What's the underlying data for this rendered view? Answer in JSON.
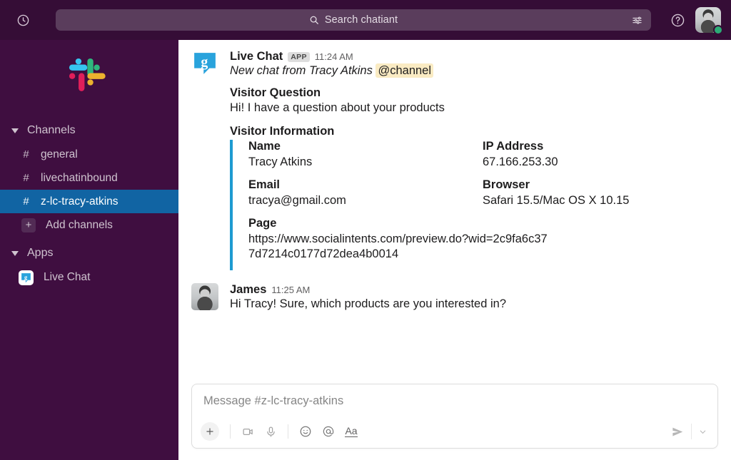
{
  "topbar": {
    "history_icon": "clock-icon",
    "search_placeholder": "Search chatiant",
    "search_icon": "search-icon",
    "filter_icon": "filter-sliders-icon",
    "help_icon": "help-circle-icon",
    "avatar_icon": "user-avatar",
    "presence": "online"
  },
  "sidebar": {
    "logo": "slack-logo",
    "sections": [
      {
        "label": "Channels",
        "items": [
          {
            "label": "general",
            "prefix": "#",
            "selected": false
          },
          {
            "label": "livechatinbound",
            "prefix": "#",
            "selected": false
          },
          {
            "label": "z-lc-tracy-atkins",
            "prefix": "#",
            "selected": true
          },
          {
            "label": "Add channels",
            "prefix": "+",
            "selected": false
          }
        ]
      },
      {
        "label": "Apps",
        "items": [
          {
            "label": "Live Chat",
            "prefix": "app",
            "selected": false
          }
        ]
      }
    ]
  },
  "messages": [
    {
      "author": "Live Chat",
      "badge": "APP",
      "time": "11:24 AM",
      "subtitle_prefix": "New chat from Tracy Atkins ",
      "mention": "@channel",
      "question_title": "Visitor Question",
      "question_text": "Hi!  I have a question about your products",
      "info_title": "Visitor Information",
      "fields": [
        {
          "label": "Name",
          "value": "Tracy Atkins"
        },
        {
          "label": "IP Address",
          "value": "67.166.253.30"
        },
        {
          "label": "Email",
          "value": "tracya@gmail.com"
        },
        {
          "label": "Browser",
          "value": "Safari 15.5/Mac OS X 10.15"
        },
        {
          "label": "Page",
          "value": "https://www.socialintents.com/preview.do?wid=2c9fa6c377d7214c0177d72dea4b0014"
        }
      ]
    },
    {
      "author": "James",
      "time": "11:25 AM",
      "text": "Hi Tracy!  Sure, which products are you interested in?"
    }
  ],
  "composer": {
    "placeholder": "Message #z-lc-tracy-atkins",
    "tools": [
      "plus-icon",
      "video-icon",
      "microphone-icon",
      "emoji-icon",
      "mention-at-icon",
      "formatting-aa-icon"
    ],
    "aa_label": "Aa",
    "send_icon": "send-icon",
    "chevron_icon": "chevron-down-icon"
  },
  "colors": {
    "sidebar_bg": "#3F0E40",
    "topbar_bg": "#350D36",
    "selected_channel": "#1164A3",
    "attachment_border": "#1D9BD1",
    "mention_highlight": "#FAEBC3",
    "presence_green": "#2BAC76",
    "app_icon_blue": "#29A3DC"
  }
}
